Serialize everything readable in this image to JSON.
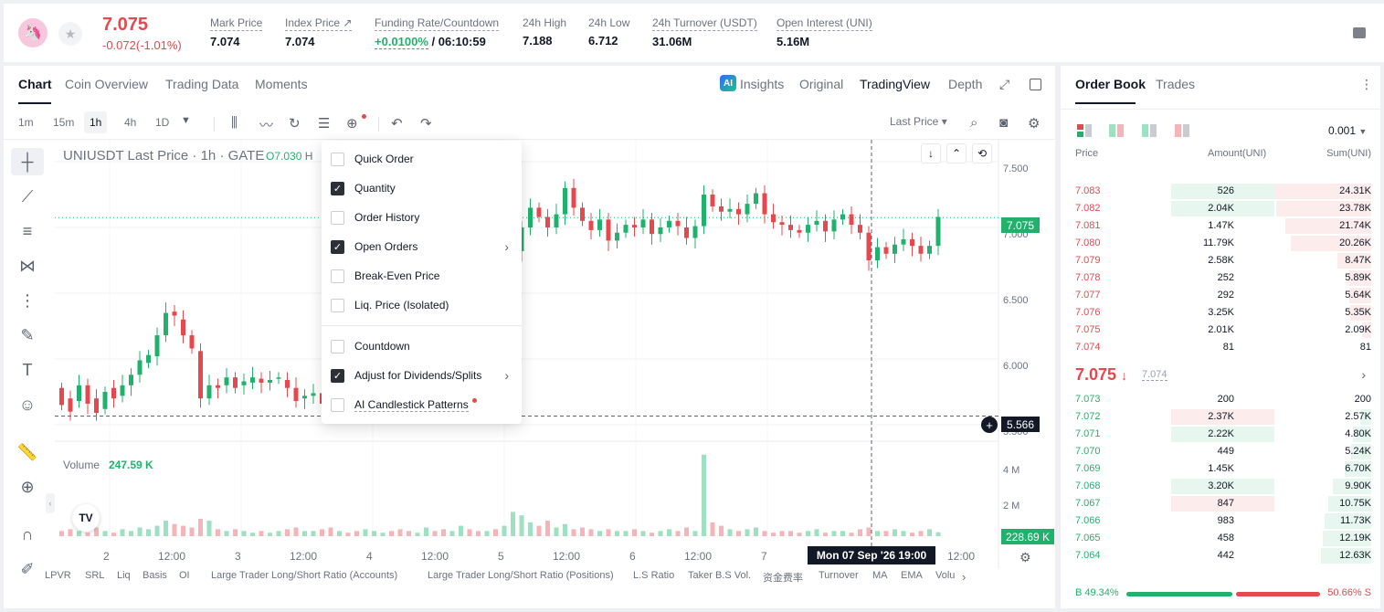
{
  "header": {
    "last_price": "7.075",
    "change": "-0.072(-1.01%)",
    "stats": [
      {
        "label": "Mark Price",
        "value": "7.074"
      },
      {
        "label": "Index Price ↗",
        "value": "7.074"
      },
      {
        "label": "Funding Rate/Countdown",
        "value_green": "+0.0100%",
        "value": " / 06:10:59"
      },
      {
        "label": "24h High",
        "value": "7.188"
      },
      {
        "label": "24h Low",
        "value": "6.712"
      },
      {
        "label": "24h Turnover (USDT)",
        "value": "31.06M"
      },
      {
        "label": "Open Interest (UNI)",
        "value": "5.16M"
      }
    ]
  },
  "chart_tabs": [
    "Chart",
    "Coin Overview",
    "Trading Data",
    "Moments"
  ],
  "view_tabs": {
    "insights": "Insights",
    "original": "Original",
    "tradingview": "TradingView",
    "depth": "Depth"
  },
  "ai_badge": "AI",
  "timeframes": [
    "1m",
    "15m",
    "1h",
    "4h",
    "1D"
  ],
  "last_price_select": "Last Price",
  "symbol_title": "UNIUSDT Last Price · 1h · GATE",
  "ohlc_o": "O7.030",
  "ohlc_h": "H",
  "volume_label": "Volume",
  "volume_value": "247.59 K",
  "dropdown": {
    "items": [
      {
        "label": "Quick Order",
        "checked": false
      },
      {
        "label": "Quantity",
        "checked": true
      },
      {
        "label": "Order History",
        "checked": false
      },
      {
        "label": "Open Orders",
        "checked": true,
        "submenu": true
      },
      {
        "label": "Break-Even Price",
        "checked": false
      },
      {
        "label": "Liq. Price (Isolated)",
        "checked": false
      },
      {
        "label": "Countdown",
        "checked": false
      },
      {
        "label": "Adjust for Dividends/Splits",
        "checked": true,
        "submenu": true
      },
      {
        "label": "AI Candlestick Patterns",
        "checked": false
      }
    ]
  },
  "price_axis": [
    "7.500",
    "7.000",
    "6.500",
    "6.000",
    "5.500"
  ],
  "volume_axis": [
    "4 M",
    "2 M"
  ],
  "price_tag": "7.075",
  "crosshair_tag": "5.566",
  "volume_tag": "228.69 K",
  "time_tag": "Mon 07 Sep '26   19:00",
  "time_ticks": [
    "2",
    "12:00",
    "3",
    "12:00",
    "4",
    "12:00",
    "5",
    "12:00",
    "6",
    "12:00",
    "7",
    "12:00"
  ],
  "tv_logo": "TV",
  "indicators": [
    "LPVR",
    "SRL",
    "Liq",
    "Basis",
    "OI",
    "Large Trader Long/Short Ratio (Accounts)",
    "Large Trader Long/Short Ratio (Positions)",
    "L.S Ratio",
    "Taker B.S Vol.",
    "资金费率",
    "Turnover",
    "MA",
    "EMA",
    "Volu"
  ],
  "chart_data": {
    "type": "candlestick",
    "title": "UNIUSDT Last Price · 1h · GATE",
    "ylim": [
      5.5,
      7.6
    ],
    "yticks": [
      5.5,
      6.0,
      6.5,
      7.0,
      7.5
    ],
    "candles": [
      [
        5.78,
        5.65
      ],
      [
        5.7,
        5.6
      ],
      [
        5.68,
        5.8
      ],
      [
        5.8,
        5.66
      ],
      [
        5.7,
        5.59
      ],
      [
        5.62,
        5.75
      ],
      [
        5.78,
        5.7
      ],
      [
        5.72,
        5.8
      ],
      [
        5.8,
        5.88
      ],
      [
        5.88,
        5.99
      ],
      [
        5.97,
        6.03
      ],
      [
        6.02,
        6.18
      ],
      [
        6.18,
        6.35
      ],
      [
        6.36,
        6.33
      ],
      [
        6.3,
        6.18
      ],
      [
        6.18,
        6.08
      ],
      [
        6.06,
        5.7
      ],
      [
        5.7,
        5.8
      ],
      [
        5.8,
        5.78
      ],
      [
        5.8,
        5.86
      ],
      [
        5.86,
        5.78
      ],
      [
        5.8,
        5.83
      ],
      [
        5.82,
        5.86
      ],
      [
        5.85,
        5.82
      ],
      [
        5.82,
        5.84
      ],
      [
        5.85,
        5.86
      ],
      [
        5.84,
        5.78
      ],
      [
        5.78,
        5.68
      ],
      [
        5.7,
        5.72
      ],
      [
        5.72,
        5.74
      ],
      [
        5.74,
        5.66
      ],
      [
        5.66,
        5.6
      ],
      [
        5.62,
        5.7
      ],
      [
        6.2,
        6.18
      ],
      [
        6.16,
        6.12
      ],
      [
        6.12,
        6.2
      ],
      [
        6.2,
        6.25
      ],
      [
        6.25,
        6.28
      ],
      [
        6.3,
        6.27
      ],
      [
        6.27,
        6.2
      ],
      [
        6.2,
        6.18
      ],
      [
        6.2,
        6.3
      ],
      [
        6.3,
        6.33
      ],
      [
        6.33,
        6.28
      ],
      [
        6.28,
        6.2
      ],
      [
        6.2,
        6.22
      ],
      [
        6.22,
        6.36
      ],
      [
        6.36,
        6.32
      ],
      [
        6.3,
        6.24
      ],
      [
        6.25,
        6.3
      ],
      [
        6.3,
        6.28
      ],
      [
        6.3,
        6.55
      ],
      [
        6.55,
        6.82
      ],
      [
        6.82,
        7.0
      ],
      [
        7.0,
        7.15
      ],
      [
        7.15,
        7.08
      ],
      [
        7.08,
        7.0
      ],
      [
        7.0,
        7.1
      ],
      [
        7.1,
        7.3
      ],
      [
        7.3,
        7.15
      ],
      [
        7.15,
        7.05
      ],
      [
        7.05,
        6.98
      ],
      [
        6.98,
        7.06
      ],
      [
        7.06,
        6.9
      ],
      [
        6.9,
        6.96
      ],
      [
        6.96,
        7.02
      ],
      [
        7.02,
        7.0
      ],
      [
        7.0,
        7.06
      ],
      [
        7.06,
        6.95
      ],
      [
        6.95,
        7.0
      ],
      [
        7.0,
        7.05
      ],
      [
        7.05,
        7.01
      ],
      [
        7.0,
        6.92
      ],
      [
        6.92,
        7.01
      ],
      [
        7.01,
        7.25
      ],
      [
        7.25,
        7.16
      ],
      [
        7.16,
        7.12
      ],
      [
        7.12,
        7.14
      ],
      [
        7.14,
        7.1
      ],
      [
        7.1,
        7.18
      ],
      [
        7.18,
        7.26
      ],
      [
        7.26,
        7.1
      ],
      [
        7.1,
        7.04
      ],
      [
        7.04,
        7.02
      ],
      [
        7.02,
        6.98
      ],
      [
        6.98,
        6.96
      ],
      [
        6.96,
        7.02
      ],
      [
        7.02,
        7.05
      ],
      [
        7.05,
        6.97
      ],
      [
        6.97,
        7.06
      ],
      [
        7.06,
        7.1
      ],
      [
        7.1,
        7.02
      ],
      [
        7.02,
        6.96
      ],
      [
        6.96,
        6.75
      ],
      [
        6.75,
        6.85
      ],
      [
        6.85,
        6.8
      ],
      [
        6.8,
        6.87
      ],
      [
        6.87,
        6.91
      ],
      [
        6.91,
        6.86
      ],
      [
        6.86,
        6.8
      ],
      [
        6.8,
        6.86
      ],
      [
        6.86,
        7.08
      ]
    ],
    "volumes": [
      0.3,
      0.4,
      0.3,
      0.2,
      0.5,
      0.3,
      0.2,
      0.4,
      0.3,
      0.5,
      0.4,
      0.6,
      0.9,
      0.7,
      0.6,
      0.5,
      1.0,
      0.9,
      0.4,
      0.3,
      0.4,
      0.3,
      0.2,
      0.3,
      0.2,
      0.3,
      0.4,
      0.5,
      0.3,
      0.3,
      0.4,
      0.5,
      0.3,
      0.2,
      0.3,
      0.4,
      0.3,
      0.2,
      0.3,
      0.4,
      0.3,
      0.2,
      0.5,
      0.3,
      0.4,
      0.3,
      0.6,
      0.4,
      0.3,
      0.3,
      0.4,
      0.6,
      1.4,
      1.2,
      0.8,
      0.6,
      0.9,
      0.5,
      0.7,
      0.4,
      0.5,
      0.4,
      0.3,
      0.4,
      0.3,
      0.3,
      0.4,
      0.3,
      0.2,
      0.3,
      0.4,
      0.3,
      0.5,
      0.3,
      4.7,
      0.8,
      0.6,
      0.4,
      0.3,
      0.4,
      0.5,
      0.3,
      0.2,
      0.3,
      0.3,
      0.2,
      0.3,
      0.4,
      0.2,
      0.3,
      0.3,
      0.2,
      0.4,
      0.5,
      0.3,
      0.3,
      0.4,
      0.3,
      0.2,
      0.3,
      0.4,
      0.23
    ]
  },
  "orderbook": {
    "tabs": [
      "Order Book",
      "Trades"
    ],
    "precision": "0.001",
    "headers": {
      "price": "Price",
      "amount": "Amount(UNI)",
      "sum": "Sum(UNI)"
    },
    "asks": [
      {
        "price": "7.083",
        "amount": "526",
        "sum": "24.31K",
        "amt_frac": 0.11,
        "sum_frac": 1.0
      },
      {
        "price": "7.082",
        "amount": "2.04K",
        "sum": "23.78K",
        "amt_frac": 0.17,
        "sum_frac": 0.98
      },
      {
        "price": "7.081",
        "amount": "1.47K",
        "sum": "21.74K",
        "amt_frac": 0.0,
        "sum_frac": 0.89
      },
      {
        "price": "7.080",
        "amount": "11.79K",
        "sum": "20.26K",
        "amt_frac": 0.0,
        "sum_frac": 0.83
      },
      {
        "price": "7.079",
        "amount": "2.58K",
        "sum": "8.47K",
        "amt_frac": 0.0,
        "sum_frac": 0.35
      },
      {
        "price": "7.078",
        "amount": "252",
        "sum": "5.89K",
        "amt_frac": 0.0,
        "sum_frac": 0.24
      },
      {
        "price": "7.077",
        "amount": "292",
        "sum": "5.64K",
        "amt_frac": 0.0,
        "sum_frac": 0.23
      },
      {
        "price": "7.076",
        "amount": "3.25K",
        "sum": "5.35K",
        "amt_frac": 0.0,
        "sum_frac": 0.22
      },
      {
        "price": "7.075",
        "amount": "2.01K",
        "sum": "2.09K",
        "amt_frac": 0.0,
        "sum_frac": 0.09
      },
      {
        "price": "7.074",
        "amount": "81",
        "sum": "81",
        "amt_frac": 0.0,
        "sum_frac": 0.0
      }
    ],
    "mid_price": "7.075",
    "mid_arrow": "↓",
    "mid_mark": "7.074",
    "bids": [
      {
        "price": "7.073",
        "amount": "200",
        "sum": "200",
        "amt_frac": 0.0,
        "sum_frac": 0.0
      },
      {
        "price": "7.072",
        "amount": "2.37K",
        "sum": "2.57K",
        "amt_frac": 0.2,
        "sum_frac": 0.11
      },
      {
        "price": "7.071",
        "amount": "2.22K",
        "sum": "4.80K",
        "amt_frac": 0.17,
        "sum_frac": 0.19
      },
      {
        "price": "7.070",
        "amount": "449",
        "sum": "5.24K",
        "amt_frac": 0.0,
        "sum_frac": 0.21
      },
      {
        "price": "7.069",
        "amount": "1.45K",
        "sum": "6.70K",
        "amt_frac": 0.0,
        "sum_frac": 0.27
      },
      {
        "price": "7.068",
        "amount": "3.20K",
        "sum": "9.90K",
        "amt_frac": 0.28,
        "sum_frac": 0.4
      },
      {
        "price": "7.067",
        "amount": "847",
        "sum": "10.75K",
        "amt_frac": 0.08,
        "sum_frac": 0.44
      },
      {
        "price": "7.066",
        "amount": "983",
        "sum": "11.73K",
        "amt_frac": 0.0,
        "sum_frac": 0.48
      },
      {
        "price": "7.065",
        "amount": "458",
        "sum": "12.19K",
        "amt_frac": 0.0,
        "sum_frac": 0.5
      },
      {
        "price": "7.064",
        "amount": "442",
        "sum": "12.63K",
        "amt_frac": 0.0,
        "sum_frac": 0.52
      }
    ],
    "ratio": {
      "buy": "B 49.34%",
      "sell": "50.66% S"
    }
  },
  "colors": {
    "up": "#20b26c",
    "down": "#e5484d"
  }
}
